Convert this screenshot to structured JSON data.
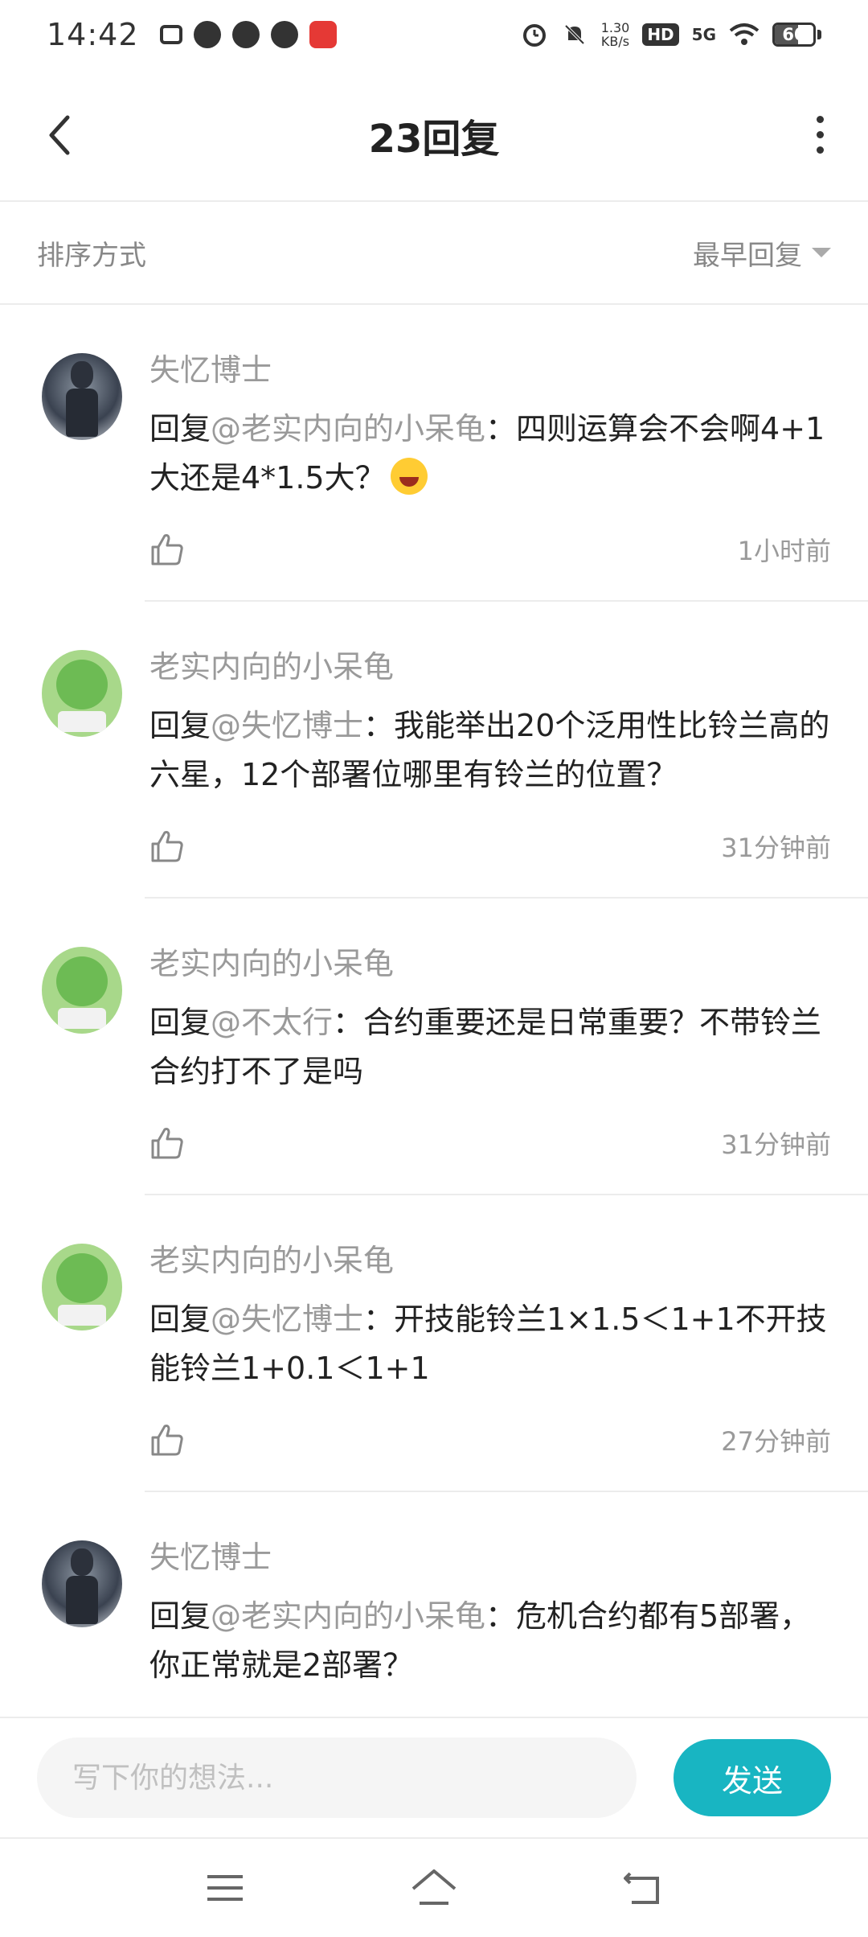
{
  "status_bar": {
    "time": "14:42",
    "net_speed_value": "1.30",
    "net_speed_unit": "KB/s",
    "hd": "HD",
    "network": "5G",
    "battery": "60",
    "battery_level": 0.6
  },
  "header": {
    "title": "23回复"
  },
  "sort": {
    "label": "排序方式",
    "selected": "最早回复"
  },
  "comments": [
    {
      "author": "失忆博士",
      "reply_prefix": "回复",
      "mention": "@老实内向的小呆龟",
      "text": "：四则运算会不会啊4+1大还是4*1.5大？",
      "emoji": "laughing-tears-emoji",
      "time": "1小时前"
    },
    {
      "author": "老实内向的小呆龟",
      "reply_prefix": "回复",
      "mention": "@失忆博士",
      "text": "：我能举出20个泛用性比铃兰高的六星，12个部署位哪里有铃兰的位置？",
      "time": "31分钟前"
    },
    {
      "author": "老实内向的小呆龟",
      "reply_prefix": "回复",
      "mention": "@不太行",
      "text": "：合约重要还是日常重要？不带铃兰合约打不了是吗",
      "time": "31分钟前"
    },
    {
      "author": "老实内向的小呆龟",
      "reply_prefix": "回复",
      "mention": "@失忆博士",
      "text": "：开技能铃兰1×1.5＜1+1不开技能铃兰1+0.1＜1+1",
      "time": "27分钟前"
    },
    {
      "author": "失忆博士",
      "reply_prefix": "回复",
      "mention": "@老实内向的小呆龟",
      "text": "：危机合约都有5部署，你正常就是2部署？"
    }
  ],
  "input_bar": {
    "placeholder": "写下你的想法...",
    "send_label": "发送"
  },
  "colors": {
    "accent": "#18b5c2",
    "muted_text": "#9a9a9a",
    "divider": "#ececec"
  }
}
